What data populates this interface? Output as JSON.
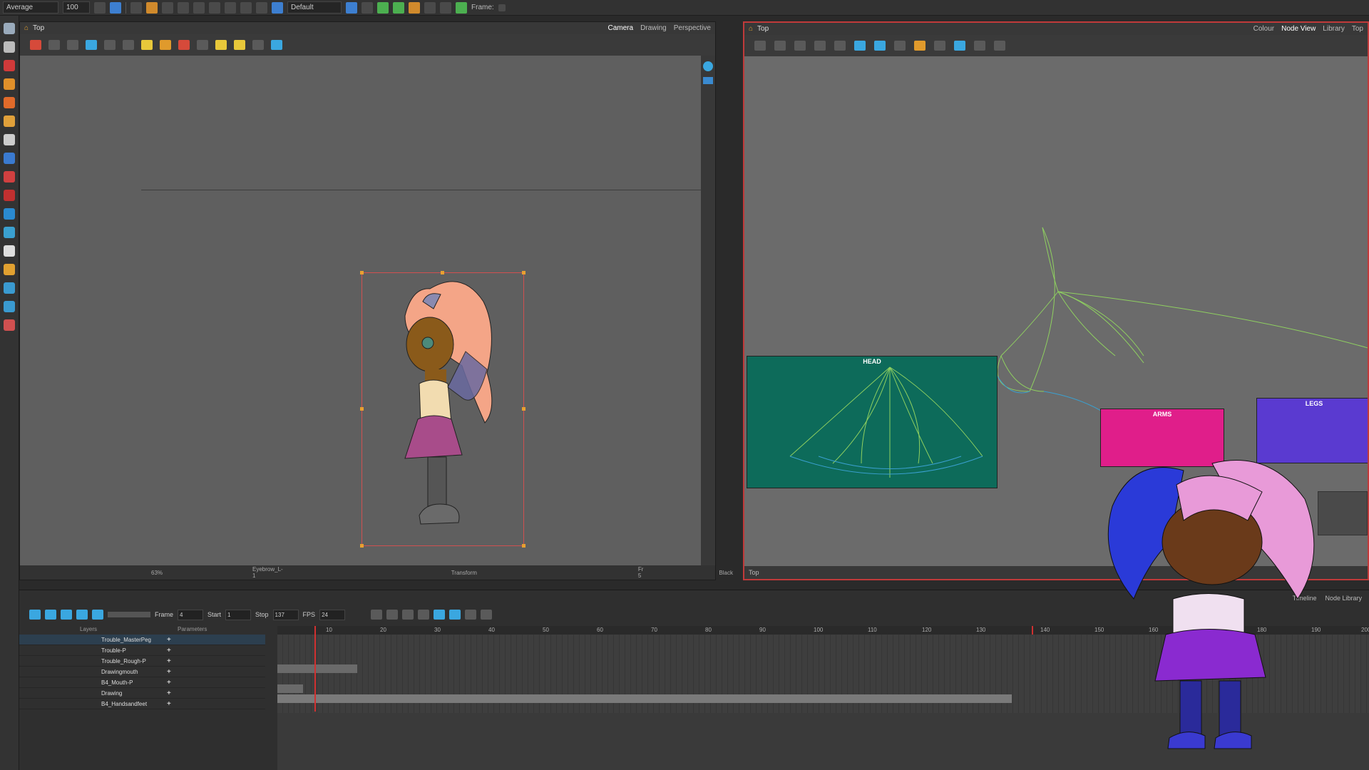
{
  "toolbar": {
    "mode": "Average",
    "zoom": "100",
    "workspace": "Default",
    "frame_label": "Frame:"
  },
  "camera": {
    "title": "Top",
    "tabs": [
      "Camera",
      "Drawing",
      "Perspective"
    ],
    "status": {
      "zoom": "63%",
      "layer": "Eyebrow_L-1",
      "tool": "Transform",
      "frame": "Fr 5",
      "color": "Black"
    }
  },
  "node_view": {
    "title": "Top",
    "tabs": [
      "Colour",
      "Node View",
      "Library",
      "Top"
    ],
    "groups": {
      "head": "HEAD",
      "arms": "ARMS",
      "legs": "LEGS"
    },
    "footer": "Top"
  },
  "timeline": {
    "tabs": [
      "Timeline",
      "Node Library"
    ],
    "frame_label": "Frame",
    "frame_value": "4",
    "start_label": "Start",
    "start_value": "1",
    "stop_label": "Stop",
    "stop_value": "137",
    "fps_label": "FPS",
    "fps_value": "24",
    "layers_header": "Layers",
    "params_header": "Parameters",
    "layers": [
      {
        "name": "Trouble_MasterPeg",
        "selected": true
      },
      {
        "name": "Trouble-P"
      },
      {
        "name": "Trouble_Rough-P"
      },
      {
        "name": "Drawingmouth"
      },
      {
        "name": "B4_Mouth-P"
      },
      {
        "name": "Drawing"
      },
      {
        "name": "B4_Handsandfeet"
      }
    ],
    "ruler": [
      "10",
      "20",
      "30",
      "40",
      "50",
      "60",
      "70",
      "80",
      "90",
      "100",
      "110",
      "120",
      "130",
      "140",
      "150",
      "160",
      "170",
      "180",
      "190",
      "200"
    ]
  },
  "colors": {
    "head_group": "#0d6b5a",
    "arms_group": "#e01e8a",
    "legs_group": "#5a3ad0",
    "selection": "#d05050"
  }
}
